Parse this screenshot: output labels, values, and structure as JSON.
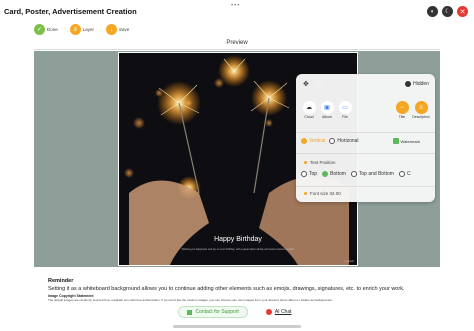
{
  "header": {
    "dots": "•••",
    "title": "Card, Poster, Advertisement Creation"
  },
  "actions": [
    {
      "label": "Done",
      "icon": "check-icon"
    },
    {
      "label": "Layer",
      "icon": "layer-icon"
    },
    {
      "label": "Save",
      "icon": "save-icon"
    }
  ],
  "preview_label": "Preview",
  "card": {
    "title": "Happy Birthday",
    "subtitle": "Wishing you happiness and joy on your birthday, with a great about all day and sweet dreams at night."
  },
  "panel": {
    "hidden_label": "Hidden",
    "tools": [
      {
        "label": "Cloud",
        "icon": "cloud-icon"
      },
      {
        "label": "Album",
        "icon": "album-icon"
      },
      {
        "label": "File",
        "icon": "file-icon"
      }
    ],
    "tools_right": [
      {
        "label": "Title",
        "icon": "title-icon"
      },
      {
        "label": "Description",
        "icon": "description-icon"
      }
    ],
    "orientation": [
      "Vertical",
      "Horizonal"
    ],
    "watermark": "Watermark",
    "text_position_label": "Text Position",
    "positions": [
      "Top",
      "Bottom",
      "Top and Bottom",
      "C"
    ],
    "font_size_label": "Font size 34.00"
  },
  "reminder": {
    "title": "Reminder",
    "text": "Setting it as a whiteboard background allows you to continue adding other elements such as emojis, drawings, signatures, etc. to enrich your work.",
    "copyright_title": "Image Copyright Statement",
    "copyright_text": "The default images are randomly sourced from unsplash.com with free authorization. If you don't like the random images, you can choose your own images from your device's photo album or folders as backgrounds."
  },
  "bottom": {
    "support": "Contact for Support",
    "ai_chat": "AI Chat"
  },
  "colors": {
    "accent_orange": "#f5a623",
    "accent_green": "#7cc04a",
    "canvas_bg": "#8e9f99"
  }
}
